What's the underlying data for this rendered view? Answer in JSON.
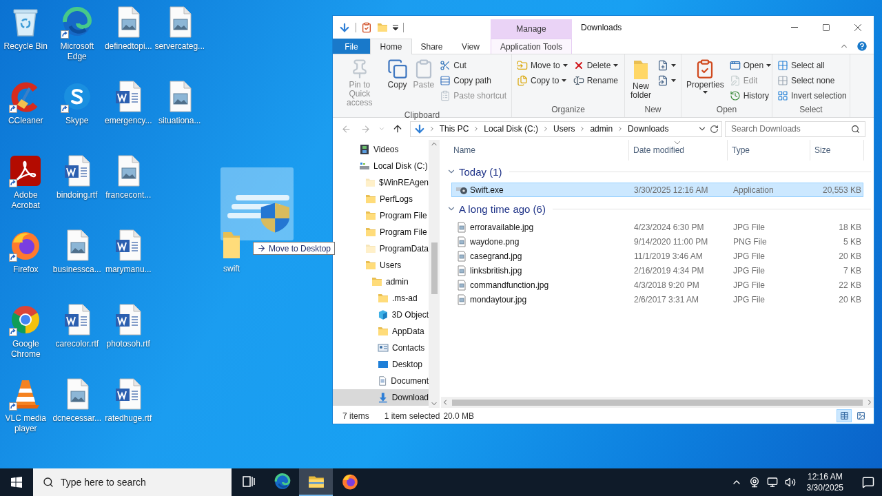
{
  "desktop": {
    "icons": [
      {
        "label": "Recycle Bin",
        "kind": "recycle-bin",
        "shortcut": false
      },
      {
        "label": "CCleaner",
        "kind": "ccleaner",
        "shortcut": true
      },
      {
        "label": "Adobe Acrobat",
        "kind": "acrobat",
        "shortcut": true
      },
      {
        "label": "Firefox",
        "kind": "firefox",
        "shortcut": true
      },
      {
        "label": "Google Chrome",
        "kind": "chrome",
        "shortcut": true
      },
      {
        "label": "VLC media player",
        "kind": "vlc",
        "shortcut": true
      },
      {
        "label": "Microsoft Edge",
        "kind": "edge",
        "shortcut": true
      },
      {
        "label": "Skype",
        "kind": "skype",
        "shortcut": true
      },
      {
        "label": "bindoing.rtf",
        "kind": "document",
        "shortcut": false
      },
      {
        "label": "businessca...",
        "kind": "image",
        "shortcut": false
      },
      {
        "label": "carecolor.rtf",
        "kind": "document",
        "shortcut": false
      },
      {
        "label": "dcnecessar...",
        "kind": "image",
        "shortcut": false
      },
      {
        "label": "definedtopi...",
        "kind": "image",
        "shortcut": false
      },
      {
        "label": "emergency...",
        "kind": "document",
        "shortcut": false
      },
      {
        "label": "francecont...",
        "kind": "image",
        "shortcut": false
      },
      {
        "label": "marymanu...",
        "kind": "document",
        "shortcut": false
      },
      {
        "label": "photosoh.rtf",
        "kind": "document",
        "shortcut": false
      },
      {
        "label": "ratedhuge.rtf",
        "kind": "document",
        "shortcut": false
      },
      {
        "label": "servercateg...",
        "kind": "image",
        "shortcut": false
      },
      {
        "label": "situationa...",
        "kind": "image",
        "shortcut": false
      }
    ]
  },
  "drag": {
    "label": "swift",
    "tooltip": "Move to Desktop"
  },
  "explorer": {
    "title": "Downloads",
    "context_group": "Manage",
    "tabs": [
      {
        "label": "File",
        "kind": "file",
        "selected": false
      },
      {
        "label": "Home",
        "kind": "tab",
        "selected": true
      },
      {
        "label": "Share",
        "kind": "tab",
        "selected": false
      },
      {
        "label": "View",
        "kind": "tab",
        "selected": false
      },
      {
        "label": "Application Tools",
        "kind": "context",
        "selected": false
      }
    ],
    "ribbon": [
      {
        "name": "Clipboard",
        "large": [
          {
            "label": "Pin to Quick access",
            "disabled": true,
            "dropdown": false
          },
          {
            "label": "Copy",
            "disabled": false,
            "dropdown": false
          },
          {
            "label": "Paste",
            "disabled": true,
            "dropdown": false
          }
        ],
        "columns": [
          [
            {
              "label": "Cut",
              "disabled": false,
              "dropdown": false
            },
            {
              "label": "Copy path",
              "disabled": false,
              "dropdown": false
            },
            {
              "label": "Paste shortcut",
              "disabled": true,
              "dropdown": false
            }
          ]
        ]
      },
      {
        "name": "Organize",
        "columns": [
          [
            {
              "label": "Move to",
              "disabled": false,
              "dropdown": true
            },
            {
              "label": "Copy to",
              "disabled": false,
              "dropdown": true
            }
          ],
          [
            {
              "label": "Delete",
              "disabled": false,
              "dropdown": true
            },
            {
              "label": "Rename",
              "disabled": false,
              "dropdown": false
            }
          ]
        ]
      },
      {
        "name": "New",
        "large": [
          {
            "label": "New folder",
            "disabled": false,
            "dropdown": false
          }
        ],
        "columns": [
          [
            {
              "disabled": false,
              "dropdown": true
            },
            {
              "disabled": false,
              "dropdown": true
            }
          ]
        ]
      },
      {
        "name": "Open",
        "large": [
          {
            "label": "Properties",
            "disabled": false,
            "dropdown": true
          }
        ],
        "columns": [
          [
            {
              "label": "Open",
              "disabled": false,
              "dropdown": true
            },
            {
              "label": "Edit",
              "disabled": true,
              "dropdown": false
            },
            {
              "label": "History",
              "disabled": false,
              "dropdown": false
            }
          ]
        ]
      },
      {
        "name": "Select",
        "columns": [
          [
            {
              "label": "Select all",
              "disabled": false,
              "dropdown": false
            },
            {
              "label": "Select none",
              "disabled": false,
              "dropdown": false
            },
            {
              "label": "Invert selection",
              "disabled": false,
              "dropdown": false
            }
          ]
        ]
      }
    ],
    "address": {
      "path": [
        "This PC",
        "Local Disk (C:)",
        "Users",
        "admin",
        "Downloads"
      ]
    },
    "search": {
      "placeholder": "Search Downloads"
    },
    "navigation": [
      {
        "label": "Videos",
        "kind": "videos",
        "hidden": false,
        "selected": false
      },
      {
        "label": "Local Disk (C:)",
        "kind": "drive",
        "hidden": false,
        "selected": false,
        "children": [
          {
            "label": "$WinREAgen",
            "kind": "folder",
            "hidden": true,
            "selected": false
          },
          {
            "label": "PerfLogs",
            "kind": "folder",
            "hidden": false,
            "selected": false
          },
          {
            "label": "Program File",
            "kind": "folder",
            "hidden": false,
            "selected": false
          },
          {
            "label": "Program File",
            "kind": "folder",
            "hidden": false,
            "selected": false
          },
          {
            "label": "ProgramData",
            "kind": "folder",
            "hidden": true,
            "selected": false
          },
          {
            "label": "Users",
            "kind": "folder",
            "hidden": false,
            "selected": false,
            "children": [
              {
                "label": "admin",
                "kind": "folder",
                "hidden": false,
                "selected": false,
                "children": [
                  {
                    "label": ".ms-ad",
                    "kind": "folder",
                    "hidden": false,
                    "selected": false
                  },
                  {
                    "label": "3D Object",
                    "kind": "cube",
                    "hidden": false,
                    "selected": false
                  },
                  {
                    "label": "AppData",
                    "kind": "folder",
                    "hidden": false,
                    "selected": false
                  },
                  {
                    "label": "Contacts",
                    "kind": "contacts",
                    "hidden": false,
                    "selected": false
                  },
                  {
                    "label": "Desktop",
                    "kind": "desktop",
                    "hidden": false,
                    "selected": false
                  },
                  {
                    "label": "Document",
                    "kind": "documents",
                    "hidden": false,
                    "selected": false
                  },
                  {
                    "label": "Download",
                    "kind": "downloads",
                    "hidden": false,
                    "selected": true
                  }
                ]
              }
            ]
          }
        ]
      }
    ],
    "columns": [
      {
        "label": "Name",
        "sorted": false
      },
      {
        "label": "Date modified",
        "sorted": true
      },
      {
        "label": "Type",
        "sorted": false
      },
      {
        "label": "Size",
        "sorted": false
      }
    ],
    "groups": [
      {
        "label": "Today (1)",
        "expanded": true,
        "files": [
          {
            "name": "Swift.exe",
            "kind": "application",
            "date": "3/30/2025 12:16 AM",
            "type": "Application",
            "size": "20,553 KB",
            "selected": true
          }
        ]
      },
      {
        "label": "A long time ago (6)",
        "expanded": true,
        "files": [
          {
            "name": "erroravailable.jpg",
            "kind": "image",
            "date": "4/23/2024 6:30 PM",
            "type": "JPG File",
            "size": "18 KB",
            "selected": false
          },
          {
            "name": "waydone.png",
            "kind": "image",
            "date": "9/14/2020 11:00 PM",
            "type": "PNG File",
            "size": "5 KB",
            "selected": false
          },
          {
            "name": "casegrand.jpg",
            "kind": "image",
            "date": "11/1/2019 3:46 AM",
            "type": "JPG File",
            "size": "20 KB",
            "selected": false
          },
          {
            "name": "linksbritish.jpg",
            "kind": "image",
            "date": "2/16/2019 4:34 PM",
            "type": "JPG File",
            "size": "7 KB",
            "selected": false
          },
          {
            "name": "commandfunction.jpg",
            "kind": "image",
            "date": "4/3/2018 9:20 PM",
            "type": "JPG File",
            "size": "22 KB",
            "selected": false
          },
          {
            "name": "mondaytour.jpg",
            "kind": "image",
            "date": "2/6/2017 3:31 AM",
            "type": "JPG File",
            "size": "20 KB",
            "selected": false
          }
        ]
      }
    ],
    "status_bar": {
      "count": "7 items",
      "selection": "1 item selected",
      "size": "20.0 MB",
      "views": [
        {
          "selected": true
        },
        {
          "selected": false
        }
      ]
    }
  },
  "taskbar": {
    "search": {
      "placeholder": "Type here to search"
    },
    "apps": [
      {
        "kind": "task-view",
        "active": false
      },
      {
        "kind": "edge",
        "active": false
      },
      {
        "kind": "explorer",
        "active": true
      },
      {
        "kind": "firefox",
        "active": false
      }
    ],
    "clock": {
      "time": "12:16 AM",
      "date": "3/30/2025"
    }
  }
}
